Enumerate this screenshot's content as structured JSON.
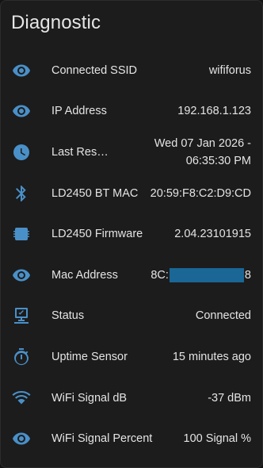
{
  "card": {
    "title": "Diagnostic"
  },
  "rows": [
    {
      "icon": "eye-icon",
      "name": "Connected SSID",
      "value": "wififorus"
    },
    {
      "icon": "eye-icon",
      "name": "IP Address",
      "value": "192.168.1.123"
    },
    {
      "icon": "clock-icon",
      "name": "Last Res…",
      "value": "Wed 07 Jan 2026 - 06:35:30 PM"
    },
    {
      "icon": "bluetooth-icon",
      "name": "LD2450 BT MAC",
      "value": "20:59:F8:C2:D9:CD"
    },
    {
      "icon": "chip-icon",
      "name": "LD2450 Firmware",
      "value": "2.04.23101915"
    },
    {
      "icon": "eye-icon",
      "name": "Mac Address",
      "value_prefix": "8C:",
      "value_suffix": "8"
    },
    {
      "icon": "lan-connect-icon",
      "name": "Status",
      "value": "Connected"
    },
    {
      "icon": "timer-icon",
      "name": "Uptime Sensor",
      "value": "15 minutes ago"
    },
    {
      "icon": "wifi-icon",
      "name": "WiFi Signal dB",
      "value": "-37 dBm"
    },
    {
      "icon": "eye-icon",
      "name": "WiFi Signal Percent",
      "value": "100 Signal %"
    }
  ],
  "colors": {
    "icon": "#4a90c8",
    "redaction": "#1a6796"
  }
}
